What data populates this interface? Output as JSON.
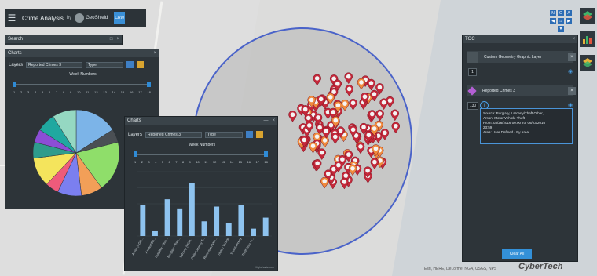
{
  "app": {
    "title": "Crime Analysis",
    "by": "by",
    "logo_text": "GeoShield",
    "badge": "CRW"
  },
  "search_panel": {
    "title": "Search"
  },
  "charts_back": {
    "title": "Charts",
    "layers_label": "Layers",
    "layer_value": "Reported Crimes 3",
    "field_value": "Type",
    "slider_title": "Week Numbers",
    "ticks": [
      "1",
      "2",
      "3",
      "4",
      "5",
      "6",
      "7",
      "8",
      "9",
      "10",
      "11",
      "12",
      "13",
      "14",
      "15",
      "16",
      "17",
      "18"
    ],
    "pie": {
      "type": "pie",
      "values": [
        16,
        5,
        19,
        8,
        9,
        5,
        11,
        6,
        5,
        7,
        9
      ],
      "colors": [
        "#7cb4e8",
        "#4a4f54",
        "#8fde6a",
        "#f29f58",
        "#7b7ff0",
        "#ee5b7b",
        "#f4e45c",
        "#2e9c8c",
        "#8c4dd6",
        "#20a8a0",
        "#95d8c2"
      ]
    }
  },
  "charts_front": {
    "title": "Charts",
    "layers_label": "Layers",
    "layer_value": "Reported Crimes 3",
    "field_value": "Type",
    "slider_title": "Week Numbers",
    "ticks": [
      "1",
      "2",
      "3",
      "4",
      "5",
      "6",
      "7",
      "8",
      "9",
      "10",
      "11",
      "12",
      "13",
      "14",
      "15",
      "16",
      "17",
      "18"
    ],
    "footer": "Highcharts.com"
  },
  "chart_data": {
    "type": "bar",
    "categories": [
      "Arson (AGG...",
      "Assault/Ba...",
      "Burglary - Bus...",
      "Burglary - Res...",
      "Larceny (NON...",
      "Petty Larceny T...",
      "Recovered Veh...",
      "Stolen Vehicle",
      "Theft/Larceny",
      "Theft/Auto Ar..."
    ],
    "values": [
      17,
      3,
      20,
      15,
      29,
      8,
      16,
      7,
      17,
      4
    ],
    "extra_bar": 10,
    "ylim": [
      0,
      35
    ],
    "color": "#8ec3ef"
  },
  "toc": {
    "title": "TOC",
    "layer1": "Custom Geometry Graphic Layer",
    "layer1_count": "1",
    "layer2": "Reported Crimes 3",
    "layer2_count": "130",
    "info_lines": [
      "Source: Burglary, Larceny/Theft Other,",
      "Arson, Motor Vehicle Theft",
      "From: 03/26/2016 00:00 To: 06/23/2016",
      "23:59",
      "Area: User Defined - By Area"
    ],
    "clear_button": "Clear All"
  },
  "nav": {
    "labels": [
      "N",
      "G",
      "A",
      "",
      "",
      "",
      ""
    ]
  },
  "map": {
    "attribution": "Esri, HERE, DeLorme, NGA, USGS, NPS",
    "watermark": "CyberTech"
  }
}
